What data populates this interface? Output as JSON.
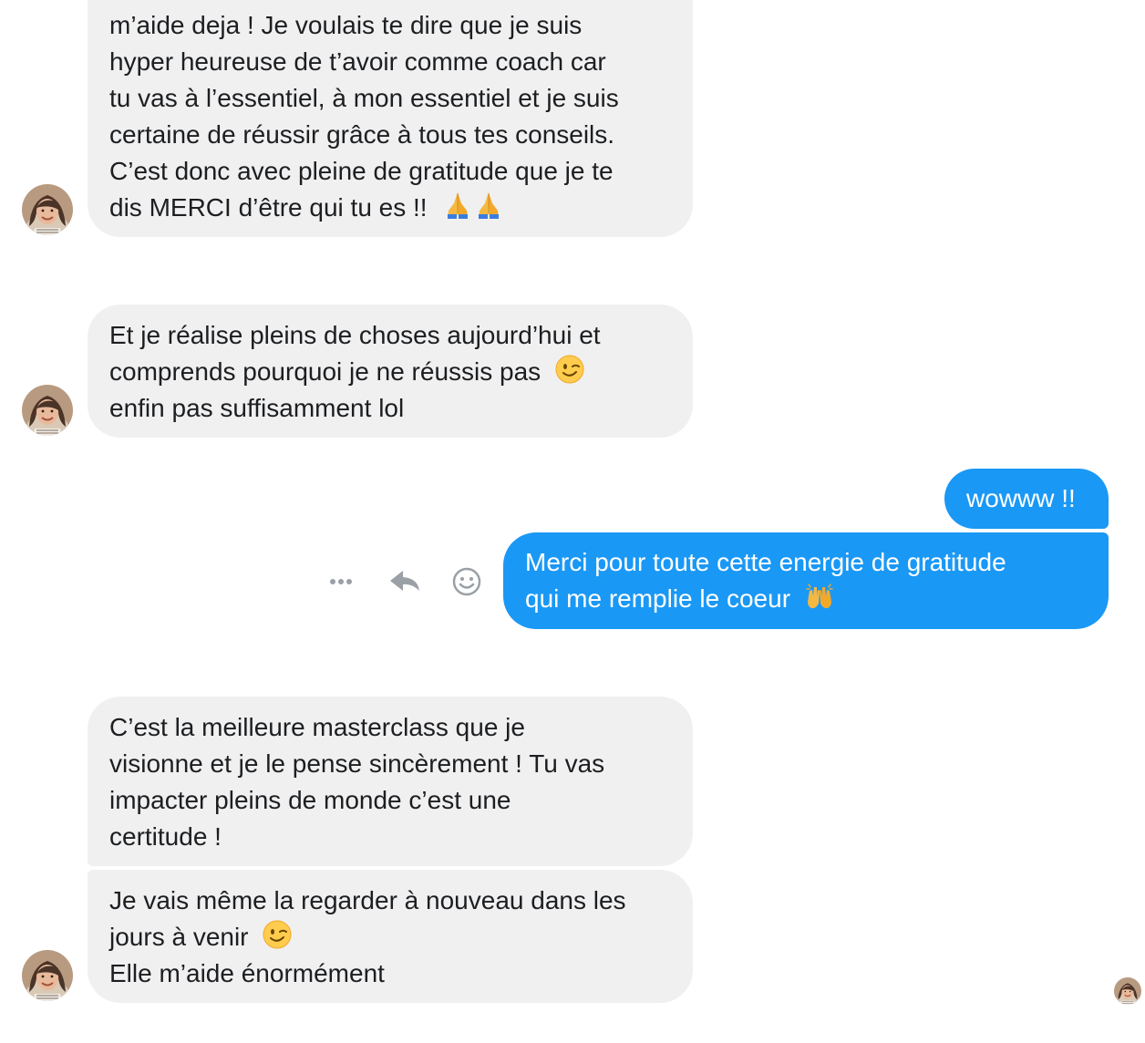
{
  "messages": {
    "m1": {
      "lines": [
        "m’aide deja ! Je voulais te dire que je suis",
        "hyper heureuse de t’avoir comme coach car",
        "tu vas à l’essentiel, à mon essentiel et je suis",
        "certaine de réussir grâce à tous tes conseils.",
        "C’est donc avec pleine de gratitude que je te",
        "dis MERCI d’être qui tu es !!"
      ],
      "emoji": "folded-hands-emoji x2"
    },
    "m2": {
      "lines": [
        "Et je réalise pleins de choses aujourd’hui et",
        "comprends pourquoi je ne réussis pas",
        "enfin pas suffisamment lol"
      ],
      "emoji": "winking-face-emoji"
    },
    "m3": {
      "text": "wowww !!"
    },
    "m4": {
      "lines": [
        "Merci pour toute cette energie de gratitude",
        "qui me remplie le coeur"
      ],
      "emoji": "raising-hands-emoji"
    },
    "m5": {
      "lines": [
        "C’est la meilleure masterclass que je",
        "visionne et je le pense sincèrement ! Tu vas",
        "impacter pleins de monde c’est une",
        "certitude !"
      ]
    },
    "m6": {
      "lines": [
        "Je vais même la regarder à nouveau dans les",
        "jours à venir",
        "Elle m’aide énormément"
      ],
      "emoji": "winking-face-emoji"
    }
  },
  "actions": [
    "more-icon",
    "reply-icon",
    "react-icon"
  ],
  "colors": {
    "incoming_bubble": "#f0f0f0",
    "outgoing_bubble": "#1a98f5",
    "incoming_text": "#1c1e21",
    "outgoing_text": "#ffffff",
    "action_icon": "#9aa0a6"
  }
}
